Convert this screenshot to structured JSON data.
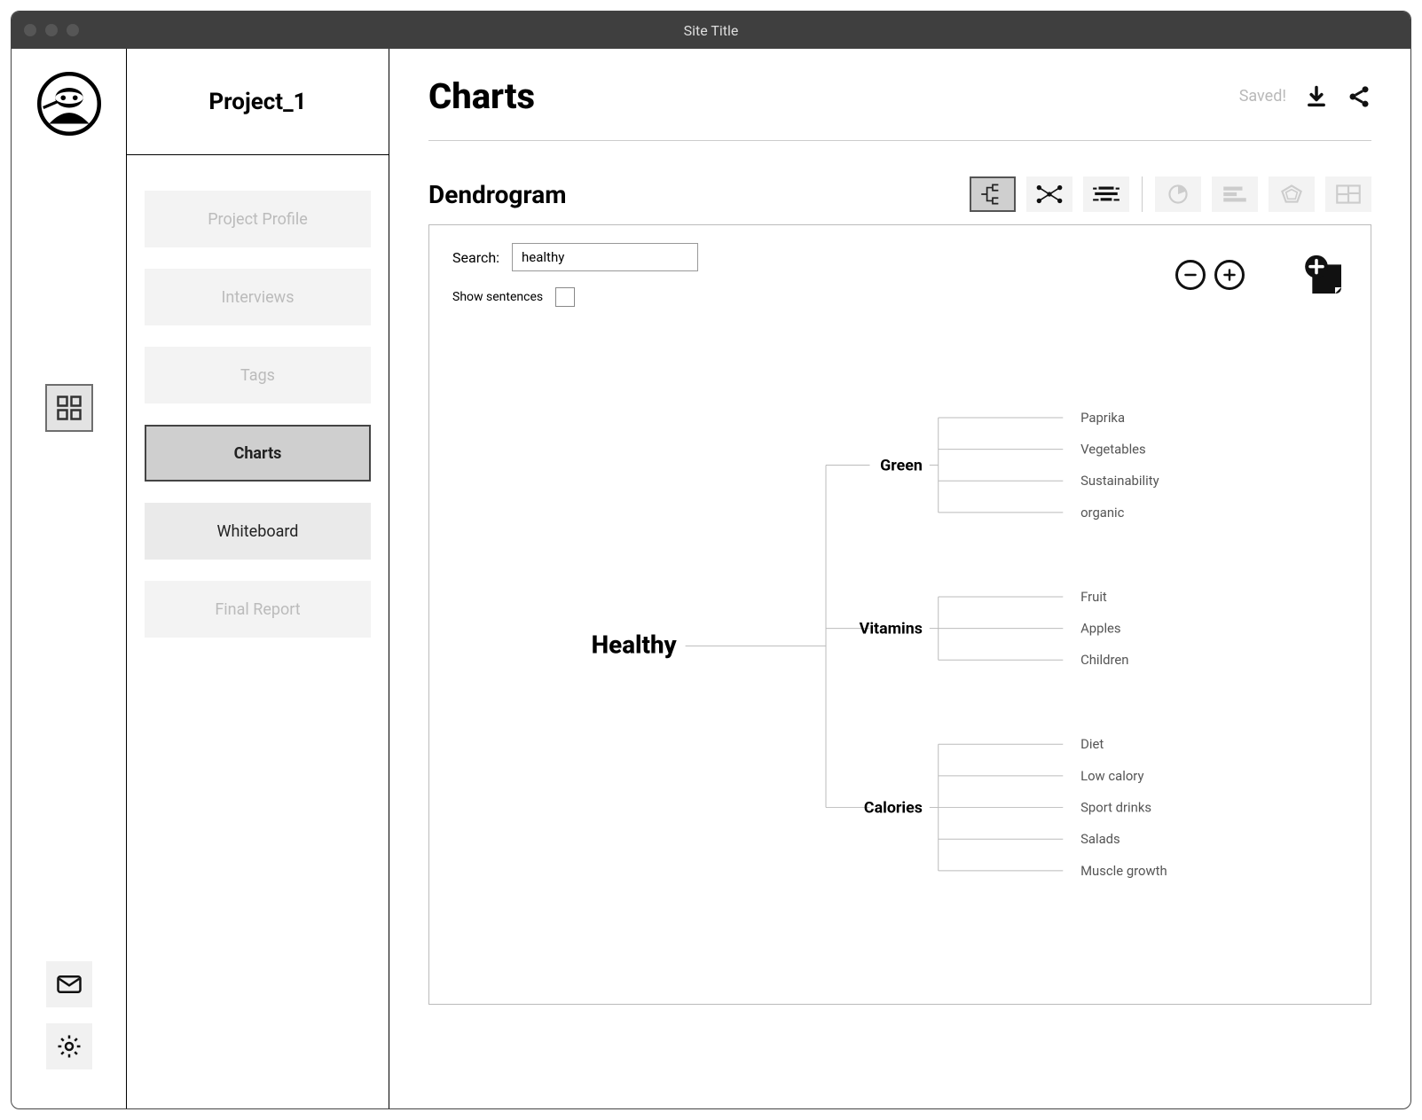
{
  "window": {
    "title": "Site Title"
  },
  "sidebar": {
    "project": "Project_1",
    "items": [
      {
        "label": "Project Profile",
        "state": "dim"
      },
      {
        "label": "Interviews",
        "state": "dim"
      },
      {
        "label": "Tags",
        "state": "dim"
      },
      {
        "label": "Charts",
        "state": "active"
      },
      {
        "label": "Whiteboard",
        "state": "secondary"
      },
      {
        "label": "Final Report",
        "state": "dim"
      }
    ]
  },
  "header": {
    "title": "Charts",
    "saved_label": "Saved!"
  },
  "section": {
    "title": "Dendrogram",
    "chart_types": [
      {
        "name": "dendrogram",
        "selected": true
      },
      {
        "name": "network",
        "selected": false
      },
      {
        "name": "stream",
        "selected": false
      },
      {
        "name": "pie",
        "selected": false,
        "disabled": true
      },
      {
        "name": "bars",
        "selected": false,
        "disabled": true
      },
      {
        "name": "radar",
        "selected": false,
        "disabled": true
      },
      {
        "name": "treemap",
        "selected": false,
        "disabled": true
      }
    ]
  },
  "controls": {
    "search_label": "Search:",
    "search_value": "healthy",
    "show_sentences_label": "Show sentences",
    "show_sentences_checked": false
  },
  "chart_data": {
    "type": "dendrogram",
    "root": "Healthy",
    "children": [
      {
        "label": "Green",
        "leaves": [
          "Paprika",
          "Vegetables",
          "Sustainability",
          "organic"
        ]
      },
      {
        "label": "Vitamins",
        "leaves": [
          "Fruit",
          "Apples",
          "Children"
        ]
      },
      {
        "label": "Calories",
        "leaves": [
          "Diet",
          "Low calory",
          "Sport drinks",
          "Salads",
          "Muscle growth"
        ]
      }
    ]
  }
}
